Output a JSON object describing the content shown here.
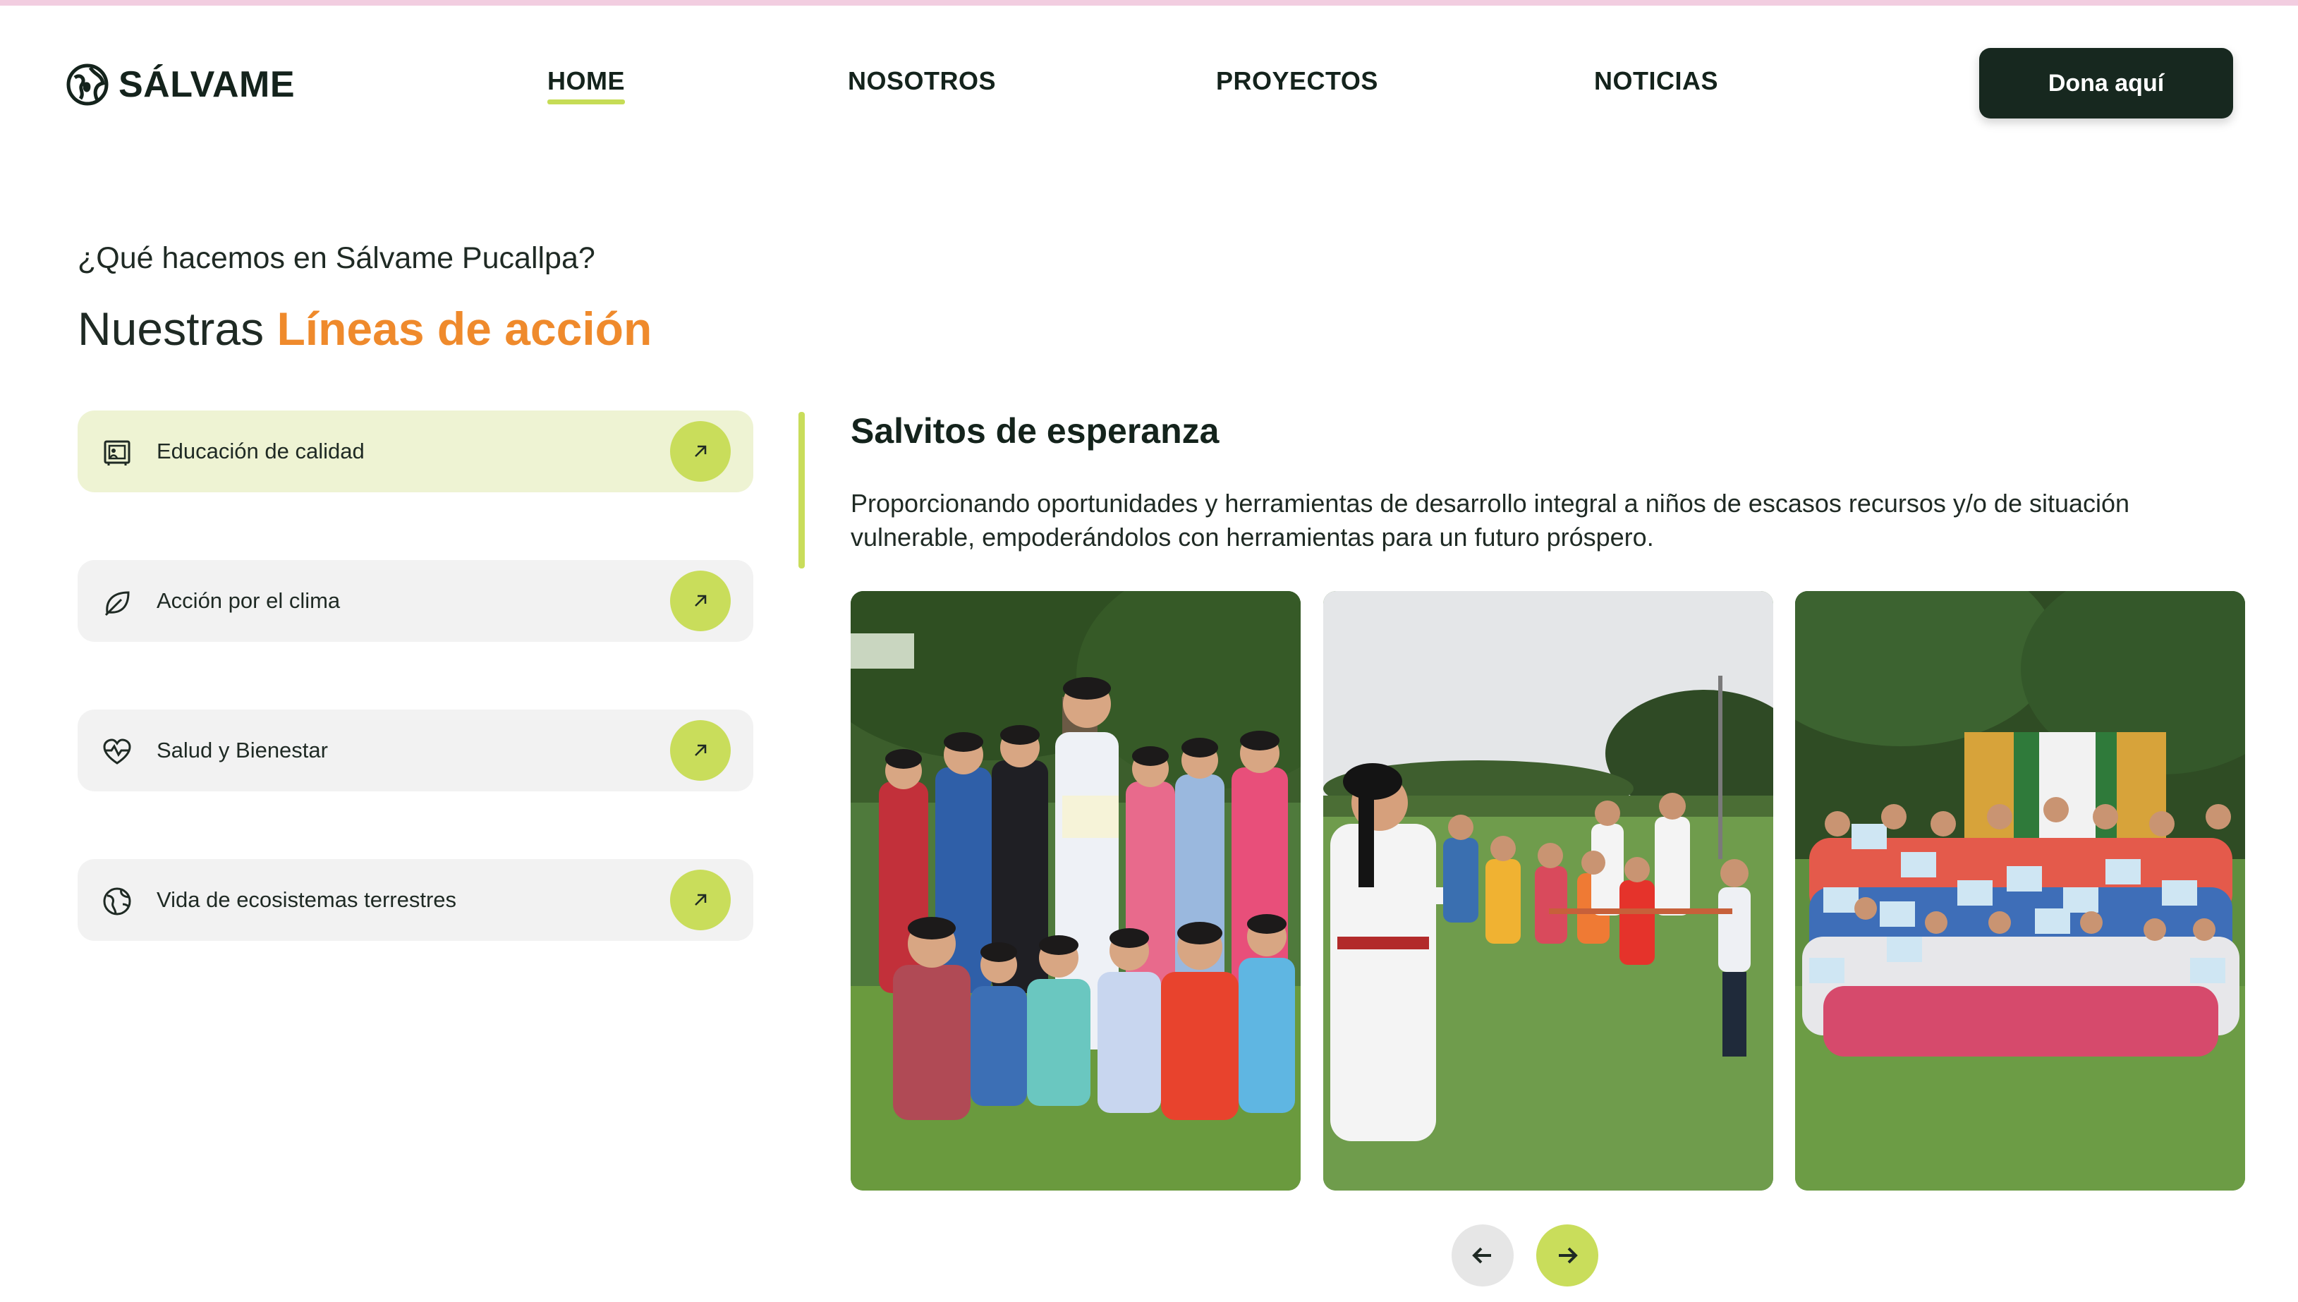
{
  "brand": {
    "name": "SÁLVAME"
  },
  "nav": {
    "items": [
      {
        "label": "HOME",
        "active": true
      },
      {
        "label": "NOSOTROS",
        "active": false
      },
      {
        "label": "PROYECTOS",
        "active": false
      },
      {
        "label": "NOTICIAS",
        "active": false
      }
    ],
    "donate_label": "Dona aquí"
  },
  "intro": {
    "kicker": "¿Qué hacemos en Sálvame Pucallpa?",
    "heading_plain": "Nuestras ",
    "heading_accent": "Líneas de acción"
  },
  "lines": [
    {
      "label": "Educación de calidad",
      "icon": "classroom-icon",
      "active": true
    },
    {
      "label": "Acción por el clima",
      "icon": "leaf-icon",
      "active": false
    },
    {
      "label": "Salud y Bienestar",
      "icon": "heart-pulse-icon",
      "active": false
    },
    {
      "label": "Vida de ecosistemas terrestres",
      "icon": "globe-icon",
      "active": false
    }
  ],
  "detail": {
    "title": "Salvitos de esperanza",
    "description": "Proporcionando oportunidades y herramientas de desarrollo integral a niños de escasos recursos y/o de situación vulnerable, empoderándolos con herramientas para un futuro próspero."
  },
  "gallery": {
    "photos": [
      {
        "icon": "group-photo-children-certificates"
      },
      {
        "icon": "karate-class-outdoors"
      },
      {
        "icon": "group-photo-diplomas"
      }
    ]
  },
  "colors": {
    "accent_orange": "#ef8a2c",
    "accent_green": "#c9dd5b",
    "dark": "#17281f",
    "active_card": "#eef3d3",
    "card": "#f2f2f2"
  }
}
